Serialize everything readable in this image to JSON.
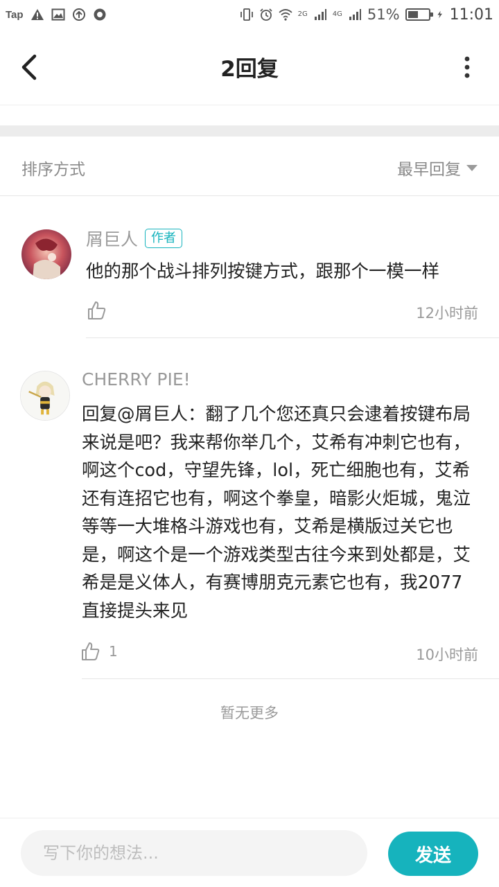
{
  "status_bar": {
    "app_label": "Tap",
    "network_2g": "2G",
    "network_4g": "4G",
    "battery_percent": "51%",
    "battery_level": 0.51,
    "time": "11:01"
  },
  "header": {
    "title": "2回复",
    "back_icon": "chevron-left-icon",
    "more_icon": "more-vertical-icon"
  },
  "sort": {
    "label": "排序方式",
    "selected": "最早回复"
  },
  "comments": [
    {
      "username": "屑巨人",
      "badge": "作者",
      "text": "他的那个战斗排列按键方式，跟那个一模一样",
      "likes": "",
      "time": "12小时前"
    },
    {
      "username": "CHERRY PIE!",
      "badge": "",
      "text": "回复@屑巨人：翻了几个您还真只会逮着按键布局来说是吧？我来帮你举几个，艾希有冲刺它也有，啊这个cod，守望先锋，lol，死亡细胞也有，艾希还有连招它也有，啊这个拳皇，暗影火炬城，鬼泣等等一大堆格斗游戏也有，艾希是横版过关它也是，啊这个是一个游戏类型古往今来到处都是，艾希是是义体人，有赛博朋克元素它也有，我2077直接提头来见",
      "likes": "1",
      "time": "10小时前"
    }
  ],
  "footer_note": "暂无更多",
  "composer": {
    "placeholder": "写下你的想法...",
    "send_label": "发送"
  },
  "colors": {
    "accent": "#16b3bd",
    "muted_text": "#999999"
  }
}
